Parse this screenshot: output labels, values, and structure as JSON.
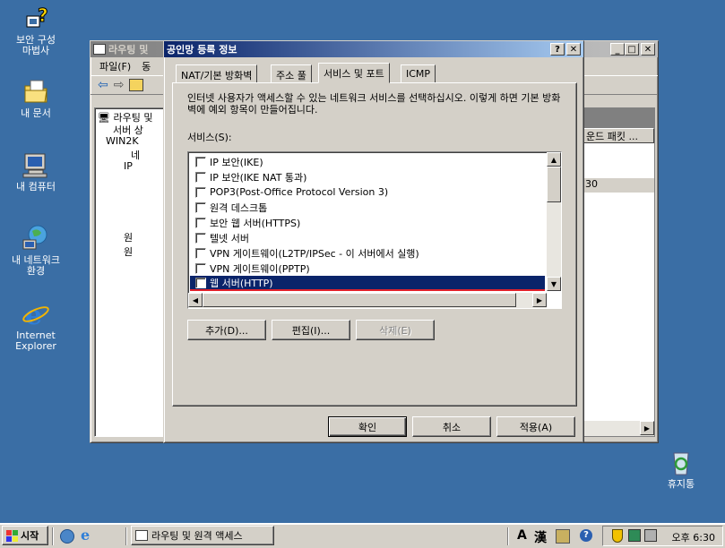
{
  "desktop": {
    "icons": [
      {
        "label1": "보안 구성",
        "label2": "마법사",
        "icon": "security-wizard-icon"
      },
      {
        "label1": "내 문서",
        "label2": "",
        "icon": "my-documents-icon"
      },
      {
        "label1": "내 컴퓨터",
        "label2": "",
        "icon": "my-computer-icon"
      },
      {
        "label1": "내 네트워크",
        "label2": "환경",
        "icon": "network-places-icon"
      },
      {
        "label1": "Internet",
        "label2": "Explorer",
        "icon": "internet-explorer-icon"
      },
      {
        "label1": "휴지통",
        "label2": "",
        "icon": "recycle-bin-icon"
      }
    ]
  },
  "bg_window": {
    "title": "라우팅 및 원격 액세스",
    "title_short": "라우팅 및",
    "menu": [
      "파일(F)",
      "동"
    ],
    "tree": [
      "라우팅 및",
      "서버 상",
      "WIN2K",
      "네",
      "IP",
      "원",
      "원"
    ],
    "col_header": "운드 패킷 ...",
    "cell_value": "30"
  },
  "dialog": {
    "title": "공인망 등록 정보",
    "tabs": [
      "NAT/기본 방화벽",
      "주소 풀",
      "서비스 및 포트",
      "ICMP"
    ],
    "active_tab": 2,
    "description": "인터넷 사용자가 액세스할 수 있는 네트워크 서비스를 선택하십시오. 이렇게 하면 기본 방화벽에 예외 항목이 만들어집니다.",
    "services_label": "서비스(S):",
    "services": [
      "IP 보안(IKE)",
      "IP 보안(IKE NAT 통과)",
      "POP3(Post-Office Protocol Version 3)",
      "원격 데스크톱",
      "보안 웹 서버(HTTPS)",
      "텔넷 서버",
      "VPN 게이트웨이(L2TP/IPSec - 이 서버에서 실행)",
      "VPN 게이트웨이(PPTP)",
      "웹 서버(HTTP)"
    ],
    "selected_service": 8,
    "btn_add": "추가(D)...",
    "btn_edit": "편집(I)...",
    "btn_delete": "삭제(E)",
    "btn_ok": "확인",
    "btn_cancel": "취소",
    "btn_apply": "적용(A)",
    "help_btn": "?",
    "close_btn": "✕"
  },
  "taskbar": {
    "start": "시작",
    "task_item": "라우팅 및 원격 액세스",
    "ime_a": "A",
    "ime_han": "漢",
    "clock": "오후 6:30"
  }
}
